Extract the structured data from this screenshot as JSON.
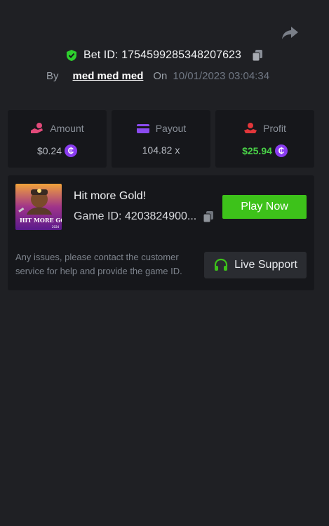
{
  "bet": {
    "label": "Bet ID: 1754599285348207623",
    "by_label": "By",
    "user": "med med med",
    "on_label": "On",
    "date": "10/01/2023 03:04:34"
  },
  "stats": {
    "amount": {
      "label": "Amount",
      "value": "$0.24",
      "icon": "hand-coins-icon"
    },
    "payout": {
      "label": "Payout",
      "value": "104.82 x",
      "icon": "card-icon"
    },
    "profit": {
      "label": "Profit",
      "value": "$25.94",
      "icon": "hand-money-icon"
    }
  },
  "game": {
    "title": "Hit more Gold!",
    "id_label": "Game ID: 4203824900...",
    "play_label": "Play Now",
    "thumb_text": "HIT MORE GOLD!",
    "thumb_tag": "2024"
  },
  "support": {
    "text": "Any issues, please contact the customer service for help and provide the game ID.",
    "button_label": "Live Support"
  },
  "colors": {
    "background": "#1f2024",
    "card": "#16171b",
    "accent_green": "#3dc21a",
    "profit_green": "#49d147",
    "coin_purple": "#8a3cf0",
    "amount_pink": "#e24a7a",
    "payout_purple": "#8b4bf0",
    "profit_red": "#e2363a"
  }
}
